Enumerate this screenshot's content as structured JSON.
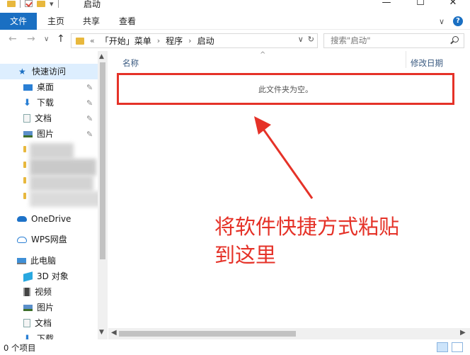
{
  "window": {
    "title": "启动",
    "minimize": "—",
    "maximize": "☐",
    "close": "✕"
  },
  "ribbon": {
    "tabs": [
      "文件",
      "主页",
      "共享",
      "查看"
    ]
  },
  "address": {
    "prefix": "«",
    "path": [
      "「开始」菜单",
      "程序",
      "启动"
    ],
    "refresh": "↻",
    "dropdown": "∨"
  },
  "search": {
    "placeholder": "搜索\"启动\""
  },
  "navpane": {
    "quick_access": "快速访问",
    "quick_items": [
      "桌面",
      "下载",
      "文档",
      "图片"
    ],
    "onedrive": "OneDrive",
    "wps": "WPS网盘",
    "this_pc": "此电脑",
    "pc_items": [
      "3D 对象",
      "视频",
      "图片",
      "文档",
      "下载"
    ]
  },
  "content": {
    "col_name": "名称",
    "col_date": "修改日期",
    "empty_message": "此文件夹为空。",
    "annotation_line1": "将软件快捷方式粘贴",
    "annotation_line2": "到这里",
    "annotation_color": "#e53228"
  },
  "status": {
    "count": "0 个项目"
  }
}
